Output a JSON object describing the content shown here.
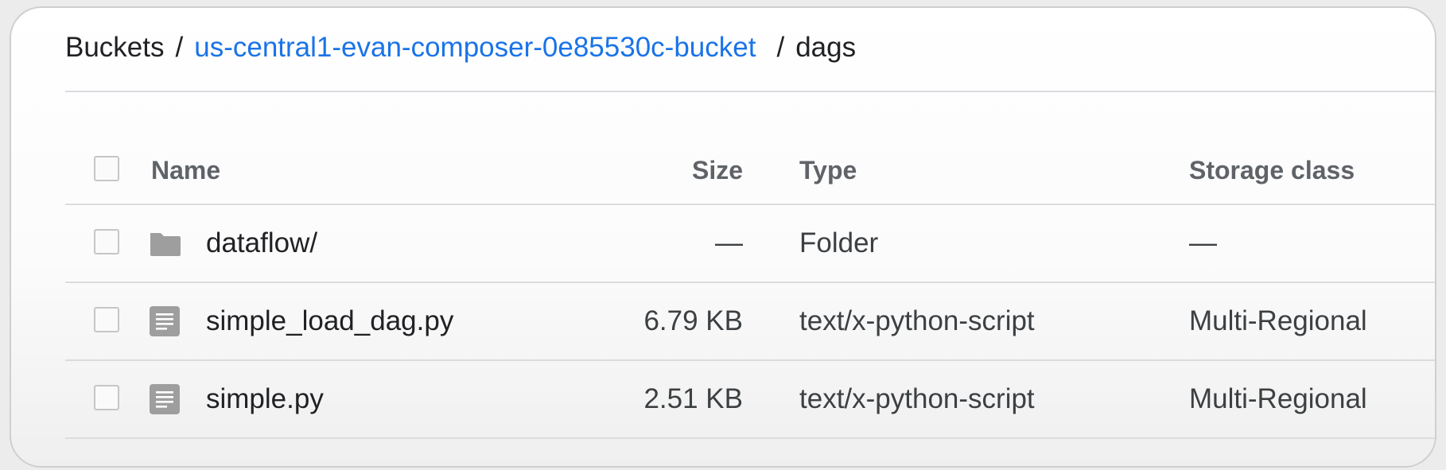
{
  "breadcrumb": {
    "root": "Buckets",
    "separator": "/",
    "bucket": "us-central1-evan-composer-0e85530c-bucket",
    "folder": "dags"
  },
  "table": {
    "columns": {
      "name": "Name",
      "size": "Size",
      "type": "Type",
      "storage_class": "Storage class"
    },
    "rows": [
      {
        "name": "dataflow/",
        "size": "—",
        "type": "Folder",
        "storage_class": "—",
        "icon": "folder-icon"
      },
      {
        "name": "simple_load_dag.py",
        "size": "6.79 KB",
        "type": "text/x-python-script",
        "storage_class": "Multi-Regional",
        "icon": "file-icon"
      },
      {
        "name": "simple.py",
        "size": "2.51 KB",
        "type": "text/x-python-script",
        "storage_class": "Multi-Regional",
        "icon": "file-icon"
      }
    ]
  },
  "colors": {
    "link": "#1a73e8",
    "icon": "#9e9e9e",
    "divider": "#dadce0"
  }
}
